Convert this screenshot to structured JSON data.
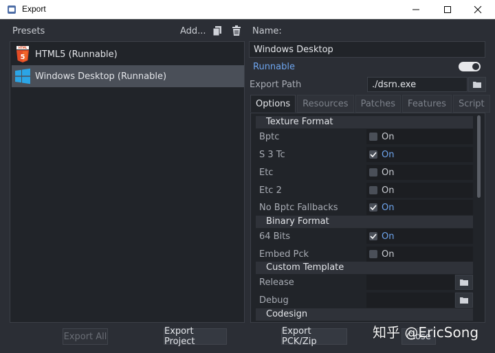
{
  "window": {
    "title": "Export"
  },
  "presets": {
    "label": "Presets",
    "add_label": "Add...",
    "items": [
      {
        "label": "HTML5 (Runnable)",
        "icon": "html5-icon"
      },
      {
        "label": "Windows Desktop (Runnable)",
        "icon": "windows-icon"
      }
    ],
    "selected_index": 1
  },
  "details": {
    "name_label": "Name:",
    "name_value": "Windows Desktop",
    "runnable_label": "Runnable",
    "runnable_on": true,
    "export_path_label": "Export Path",
    "export_path_value": "./dsrn.exe",
    "tabs": [
      "Options",
      "Resources",
      "Patches",
      "Features",
      "Script"
    ],
    "active_tab": "Options",
    "sections": {
      "texture_format": "Texture Format",
      "binary_format": "Binary Format",
      "custom_template": "Custom Template",
      "codesign": "Codesign"
    },
    "props": {
      "bptc": {
        "label": "Bptc",
        "value": "On",
        "checked": false
      },
      "s3tc": {
        "label": "S 3 Tc",
        "value": "On",
        "checked": true
      },
      "etc": {
        "label": "Etc",
        "value": "On",
        "checked": false
      },
      "etc2": {
        "label": "Etc 2",
        "value": "On",
        "checked": false
      },
      "no_bptc": {
        "label": "No Bptc Fallbacks",
        "value": "On",
        "checked": true
      },
      "bits64": {
        "label": "64 Bits",
        "value": "On",
        "checked": true
      },
      "embed_pck": {
        "label": "Embed Pck",
        "value": "On",
        "checked": false
      },
      "release": {
        "label": "Release"
      },
      "debug": {
        "label": "Debug"
      }
    }
  },
  "buttons": {
    "export_all": "Export All",
    "export_project": "Export Project",
    "export_pck": "Export PCK/Zip",
    "close": "Close"
  },
  "watermark": "知乎 @EricSong",
  "colors": {
    "accent": "#6ea5ee",
    "background": "#2b2e35",
    "panel": "#212429"
  }
}
